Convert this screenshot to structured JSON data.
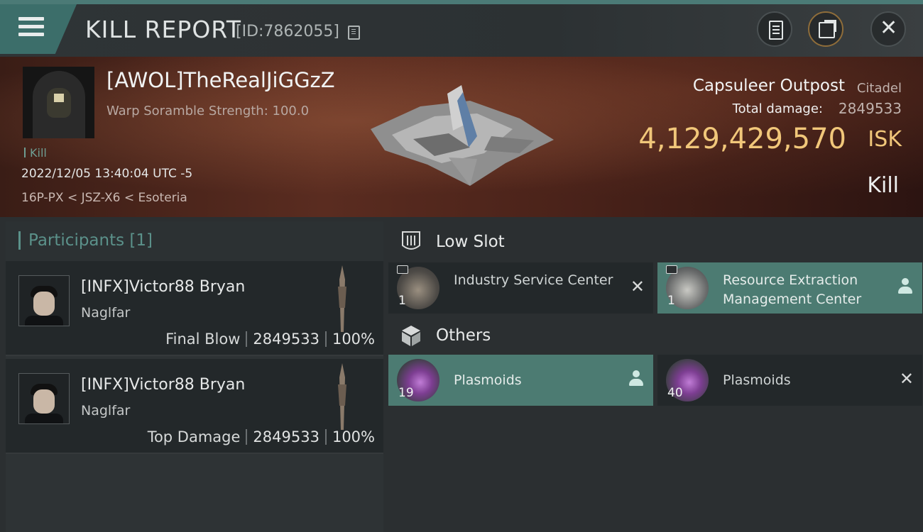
{
  "header": {
    "title": "KILL REPORT",
    "id_text": "[ID:7862055]",
    "buttons": [
      "clipboard",
      "share",
      "close"
    ]
  },
  "victim": {
    "name": "[AWOL]TheRealJiGGzZ",
    "warp_scramble": "Warp Soramble Strength: 100.0",
    "kill_count_label": "Kill",
    "datetime": "2022/12/05 13:40:04 UTC -5",
    "location": "16P-PX < JSZ-X6 < Esoteria",
    "structure_name": "Capsuleer Outpost",
    "structure_type": "Citadel",
    "total_damage_label": "Total damage:",
    "total_damage": "2849533",
    "isk_value": "4,129,429,570",
    "isk_unit": "ISK",
    "result": "Kill"
  },
  "participants": {
    "title": "Participants [1]",
    "rows": [
      {
        "name": "[INFX]Victor88 Bryan",
        "ship": "Naglfar",
        "role": "Final Blow",
        "damage": "2849533",
        "percent": "100%"
      },
      {
        "name": "[INFX]Victor88 Bryan",
        "ship": "Naglfar",
        "role": "Top Damage",
        "damage": "2849533",
        "percent": "100%"
      }
    ]
  },
  "sections": {
    "low_slot": {
      "label": "Low Slot",
      "items": [
        {
          "name": "Industry Service Center",
          "qty": "1",
          "state": "destroyed",
          "icon": "industry-service-center"
        },
        {
          "name": "Resource Extraction Management Center",
          "qty": "1",
          "state": "dropped",
          "icon": "resource-extraction-center"
        }
      ]
    },
    "others": {
      "label": "Others",
      "items": [
        {
          "name": "Plasmoids",
          "qty": "19",
          "state": "dropped",
          "icon": "plasmoid"
        },
        {
          "name": "Plasmoids",
          "qty": "40",
          "state": "destroyed",
          "icon": "plasmoid"
        }
      ]
    }
  },
  "colors": {
    "accent_teal": "#4c7b72",
    "isk_gold": "#f1c77a",
    "banner_red": "#5a2c20"
  }
}
